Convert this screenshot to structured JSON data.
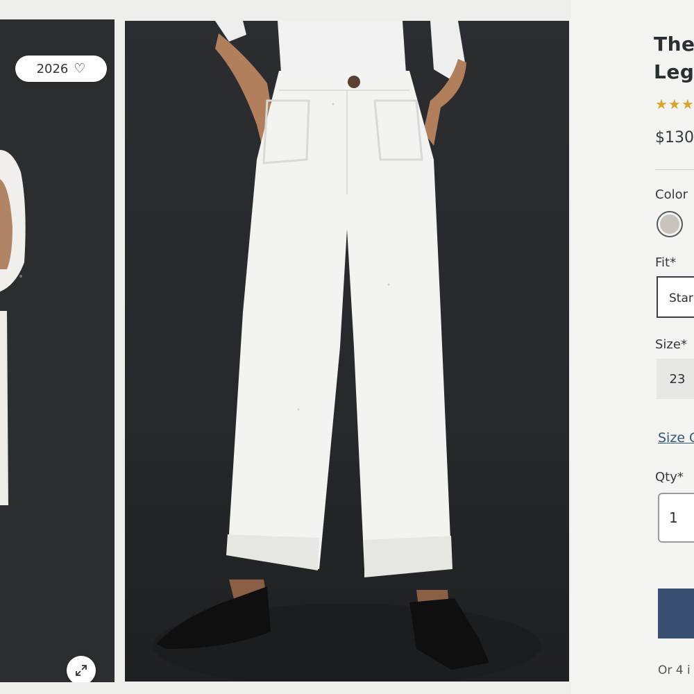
{
  "gallery": {
    "like_badge": {
      "count": "2026",
      "icon": "heart-outline-icon"
    },
    "expand_icon": "expand-arrows-icon"
  },
  "product": {
    "title_line1": "The",
    "title_line2": "Leg",
    "stars": "★★★",
    "price": "$130",
    "color_label": "Color",
    "color_swatch_hex": "#c8c4bc",
    "fit_label": "Fit*",
    "fit_value": "Star",
    "size_label": "Size*",
    "size_value": "23",
    "size_link": "Size G",
    "qty_label": "Qty*",
    "qty_value": "1",
    "add_button_color": "#394f72",
    "installments": "Or 4 i"
  }
}
